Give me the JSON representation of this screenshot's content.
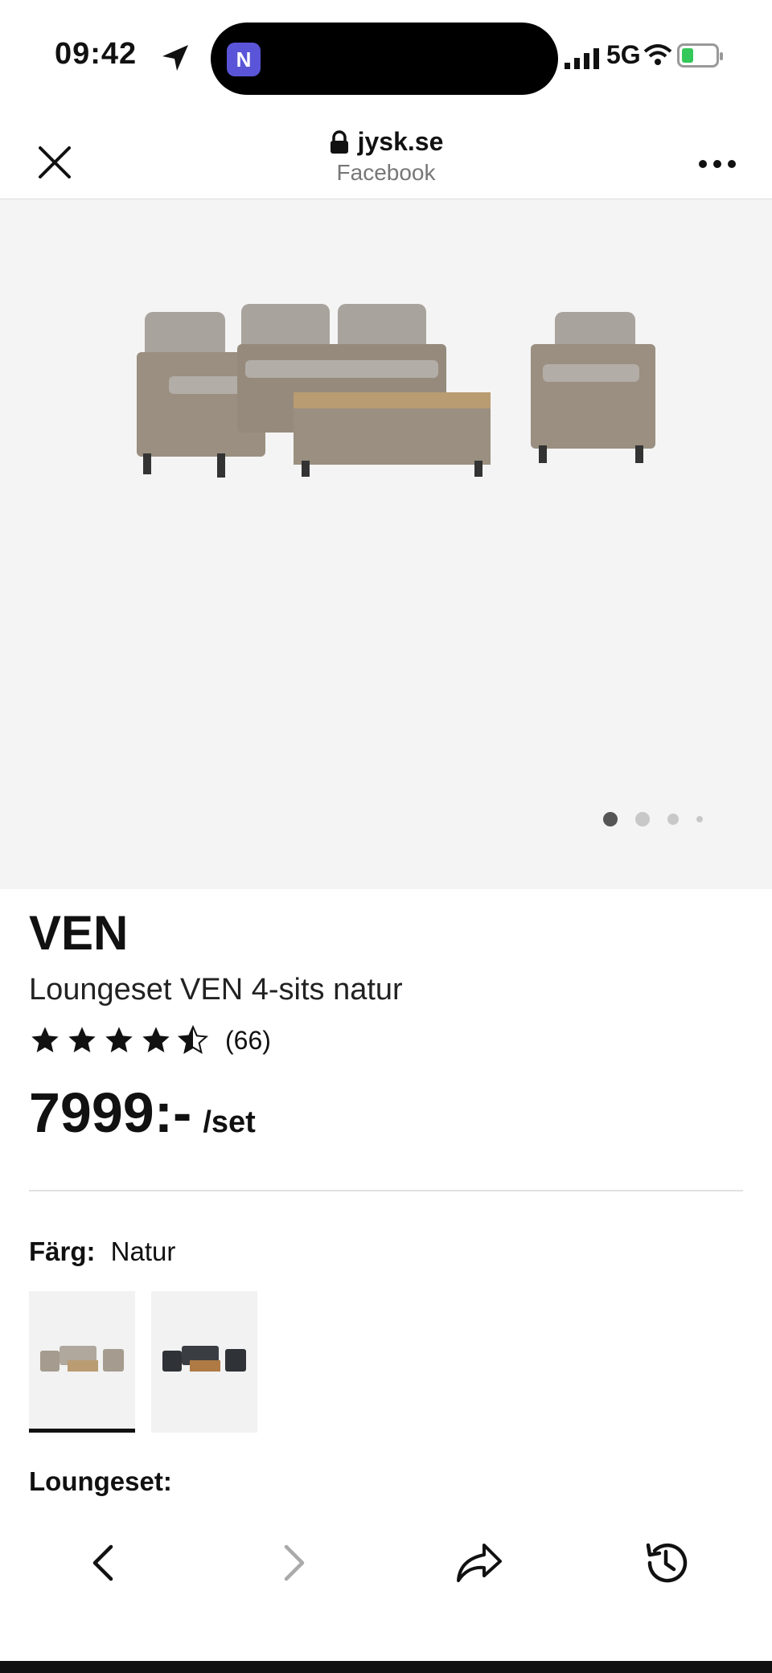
{
  "status_bar": {
    "time": "09:42",
    "app_badge": "N",
    "network": "5G"
  },
  "browser": {
    "domain": "jysk.se",
    "source": "Facebook"
  },
  "gallery": {
    "image_alt": "Loungeset VEN 4-sits natur",
    "dots_count": 4,
    "active_dot": 1
  },
  "product": {
    "brand": "VEN",
    "name": "Loungeset VEN 4-sits natur",
    "rating": 4.5,
    "rating_max": 5,
    "rating_count": "(66)",
    "price": "7999:-",
    "unit": "/set",
    "color_label": "Färg:",
    "color_value": "Natur",
    "swatches": [
      {
        "name": "Natur",
        "selected": true
      },
      {
        "name": "Svart",
        "selected": false
      }
    ],
    "section_label": "Loungeset:"
  },
  "colors": {
    "gallery_bg": "#f4f4f4",
    "rattan": "#9a8f80",
    "cushion": "#a9a39d",
    "wood": "#b99c72",
    "dark_rattan": "#2f3236"
  },
  "toolbar": {
    "icons": [
      "back-icon",
      "forward-icon",
      "share-icon",
      "history-icon"
    ]
  }
}
